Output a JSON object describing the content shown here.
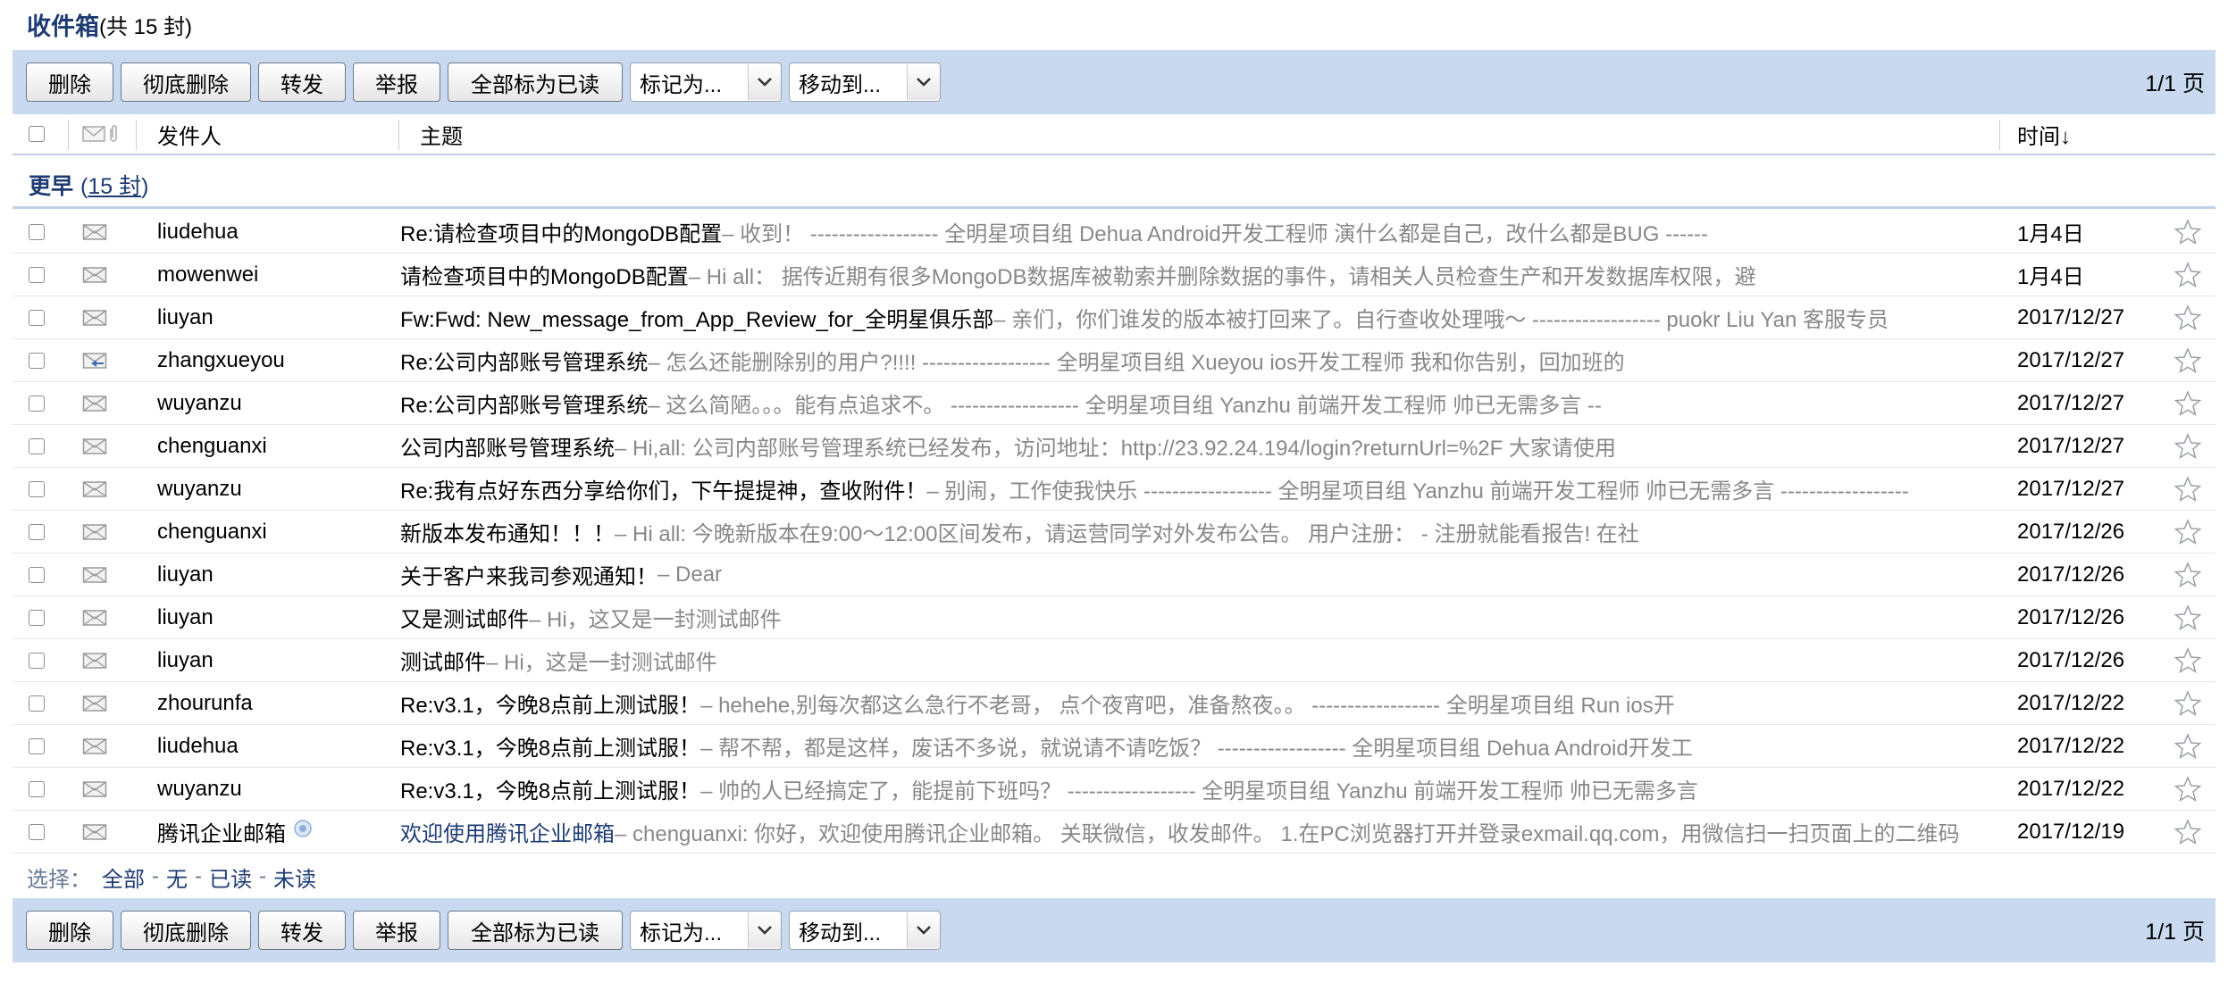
{
  "header": {
    "title": "收件箱",
    "count_text": "(共 15 封)"
  },
  "toolbar": {
    "delete": "删除",
    "delete_permanent": "彻底删除",
    "forward": "转发",
    "report": "举报",
    "mark_all_read": "全部标为已读",
    "mark_as": "标记为...",
    "move_to": "移动到...",
    "pager": "1/1 页"
  },
  "columns": {
    "sender": "发件人",
    "subject": "主题",
    "time": "时间↓"
  },
  "group": {
    "title": "更早",
    "count_prefix": "(",
    "count": "15 封",
    "count_suffix": ")"
  },
  "mails": [
    {
      "sender": "liudehua",
      "subject": "Re:请检查项目中的MongoDB配置",
      "preview": " – 收到！ ------------------ 全明星项目组 Dehua Android开发工程师 演什么都是自己，改什么都是BUG ------",
      "date": "1月4日",
      "icon": "envelope-read-icon"
    },
    {
      "sender": "mowenwei",
      "subject": "请检查项目中的MongoDB配置",
      "preview": " – Hi all： 据传近期有很多MongoDB数据库被勒索并删除数据的事件，请相关人员检查生产和开发数据库权限，避",
      "date": "1月4日",
      "icon": "envelope-read-icon"
    },
    {
      "sender": "liuyan",
      "subject": "Fw:Fwd: New_message_from_App_Review_for_全明星俱乐部",
      "preview": " – 亲们，你们谁发的版本被打回来了。自行查收处理哦～ ------------------ puokr Liu Yan 客服专员",
      "date": "2017/12/27",
      "icon": "envelope-read-icon"
    },
    {
      "sender": "zhangxueyou",
      "subject": "Re:公司内部账号管理系统",
      "preview": " – 怎么还能删除别的用户?!!!! ------------------ 全明星项目组 Xueyou ios开发工程师 我和你告别，回加班的",
      "date": "2017/12/27",
      "icon": "envelope-replied-icon"
    },
    {
      "sender": "wuyanzu",
      "subject": "Re:公司内部账号管理系统",
      "preview": " – 这么简陋。。。能有点追求不。 ------------------ 全明星项目组 Yanzhu 前端开发工程师 帅已无需多言 --",
      "date": "2017/12/27",
      "icon": "envelope-read-icon"
    },
    {
      "sender": "chenguanxi",
      "subject": "公司内部账号管理系统",
      "preview": " – Hi,all: 公司内部账号管理系统已经发布，访问地址：http://23.92.24.194/login?returnUrl=%2F 大家请使用",
      "date": "2017/12/27",
      "icon": "envelope-read-icon"
    },
    {
      "sender": "wuyanzu",
      "subject": "Re:我有点好东西分享给你们，下午提提神，查收附件！",
      "preview": " – 别闹，工作使我快乐 ------------------ 全明星项目组 Yanzhu 前端开发工程师 帅已无需多言 ------------------",
      "date": "2017/12/27",
      "icon": "envelope-read-icon"
    },
    {
      "sender": "chenguanxi",
      "subject": "新版本发布通知！！！",
      "preview": " – Hi all: 今晚新版本在9:00～12:00区间发布，请运营同学对外发布公告。 用户注册： - 注册就能看报告! 在社",
      "date": "2017/12/26",
      "icon": "envelope-read-icon"
    },
    {
      "sender": "liuyan",
      "subject": "关于客户来我司参观通知！",
      "preview": " – Dear",
      "date": "2017/12/26",
      "icon": "envelope-read-icon"
    },
    {
      "sender": "liuyan",
      "subject": "又是测试邮件",
      "preview": " – Hi，这又是一封测试邮件",
      "date": "2017/12/26",
      "icon": "envelope-read-icon"
    },
    {
      "sender": "liuyan",
      "subject": "测试邮件",
      "preview": " – Hi，这是一封测试邮件",
      "date": "2017/12/26",
      "icon": "envelope-read-icon"
    },
    {
      "sender": "zhourunfa",
      "subject": "Re:v3.1，今晚8点前上测试服！",
      "preview": " – hehehe,别每次都这么急行不老哥， 点个夜宵吧，准备熬夜。。 ------------------ 全明星项目组 Run ios开",
      "date": "2017/12/22",
      "icon": "envelope-read-icon"
    },
    {
      "sender": "liudehua",
      "subject": "Re:v3.1，今晚8点前上测试服！",
      "preview": " – 帮不帮，都是这样，废话不多说，就说请不请吃饭？ ------------------ 全明星项目组 Dehua Android开发工",
      "date": "2017/12/22",
      "icon": "envelope-read-icon"
    },
    {
      "sender": "wuyanzu",
      "subject": "Re:v3.1，今晚8点前上测试服！",
      "preview": " – 帅的人已经搞定了，能提前下班吗？ ------------------ 全明星项目组 Yanzhu 前端开发工程师 帅已无需多言",
      "date": "2017/12/22",
      "icon": "envelope-read-icon"
    },
    {
      "sender": "腾讯企业邮箱",
      "subject": "欢迎使用腾讯企业邮箱",
      "preview": " – chenguanxi: 你好，欢迎使用腾讯企业邮箱。 关联微信，收发邮件。 1.在PC浏览器打开并登录exmail.qq.com，用微信扫一扫页面上的二维码",
      "date": "2017/12/19",
      "icon": "envelope-read-icon",
      "official": true
    }
  ],
  "select_bar": {
    "label": "选择：",
    "all": "全部",
    "none": "无",
    "read": "已读",
    "unread": "未读",
    "sep": "-"
  },
  "colors": {
    "toolbar_bg": "#c9daf0",
    "title": "#1e3c74",
    "preview": "#888888"
  }
}
